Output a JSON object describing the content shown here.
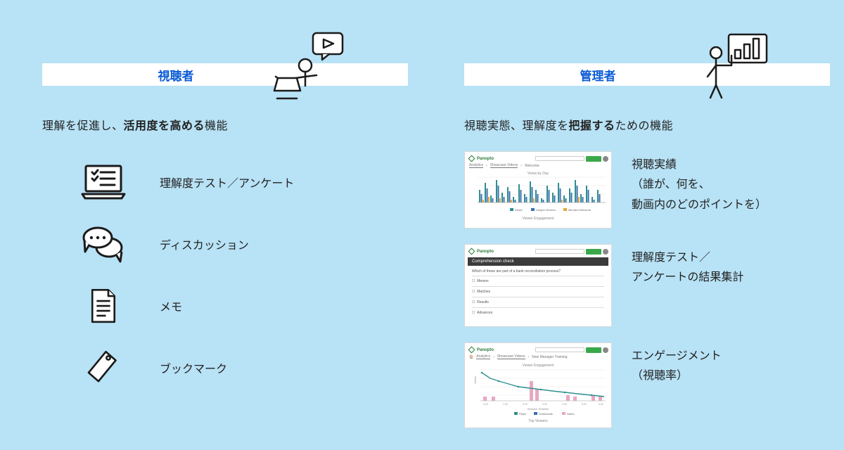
{
  "left": {
    "title": "視聴者",
    "subhead_pre": "理解を促進し、",
    "subhead_bold": "活用度を高める",
    "subhead_post": "機能",
    "features": [
      {
        "label": "理解度テスト／アンケート"
      },
      {
        "label": "ディスカッション"
      },
      {
        "label": "メモ"
      },
      {
        "label": "ブックマーク"
      }
    ]
  },
  "right": {
    "title": "管理者",
    "subhead_pre": "視聴実態、理解度を",
    "subhead_bold": "把握する",
    "subhead_post": "ための機能",
    "thumb_brand": "Panopto",
    "items": [
      {
        "label": "視聴実績\n（誰が、何を、\n動画内のどのポイントを）"
      },
      {
        "label": "理解度テスト／\nアンケートの結果集計"
      },
      {
        "label": "エンゲージメント\n（視聴率）"
      }
    ]
  }
}
